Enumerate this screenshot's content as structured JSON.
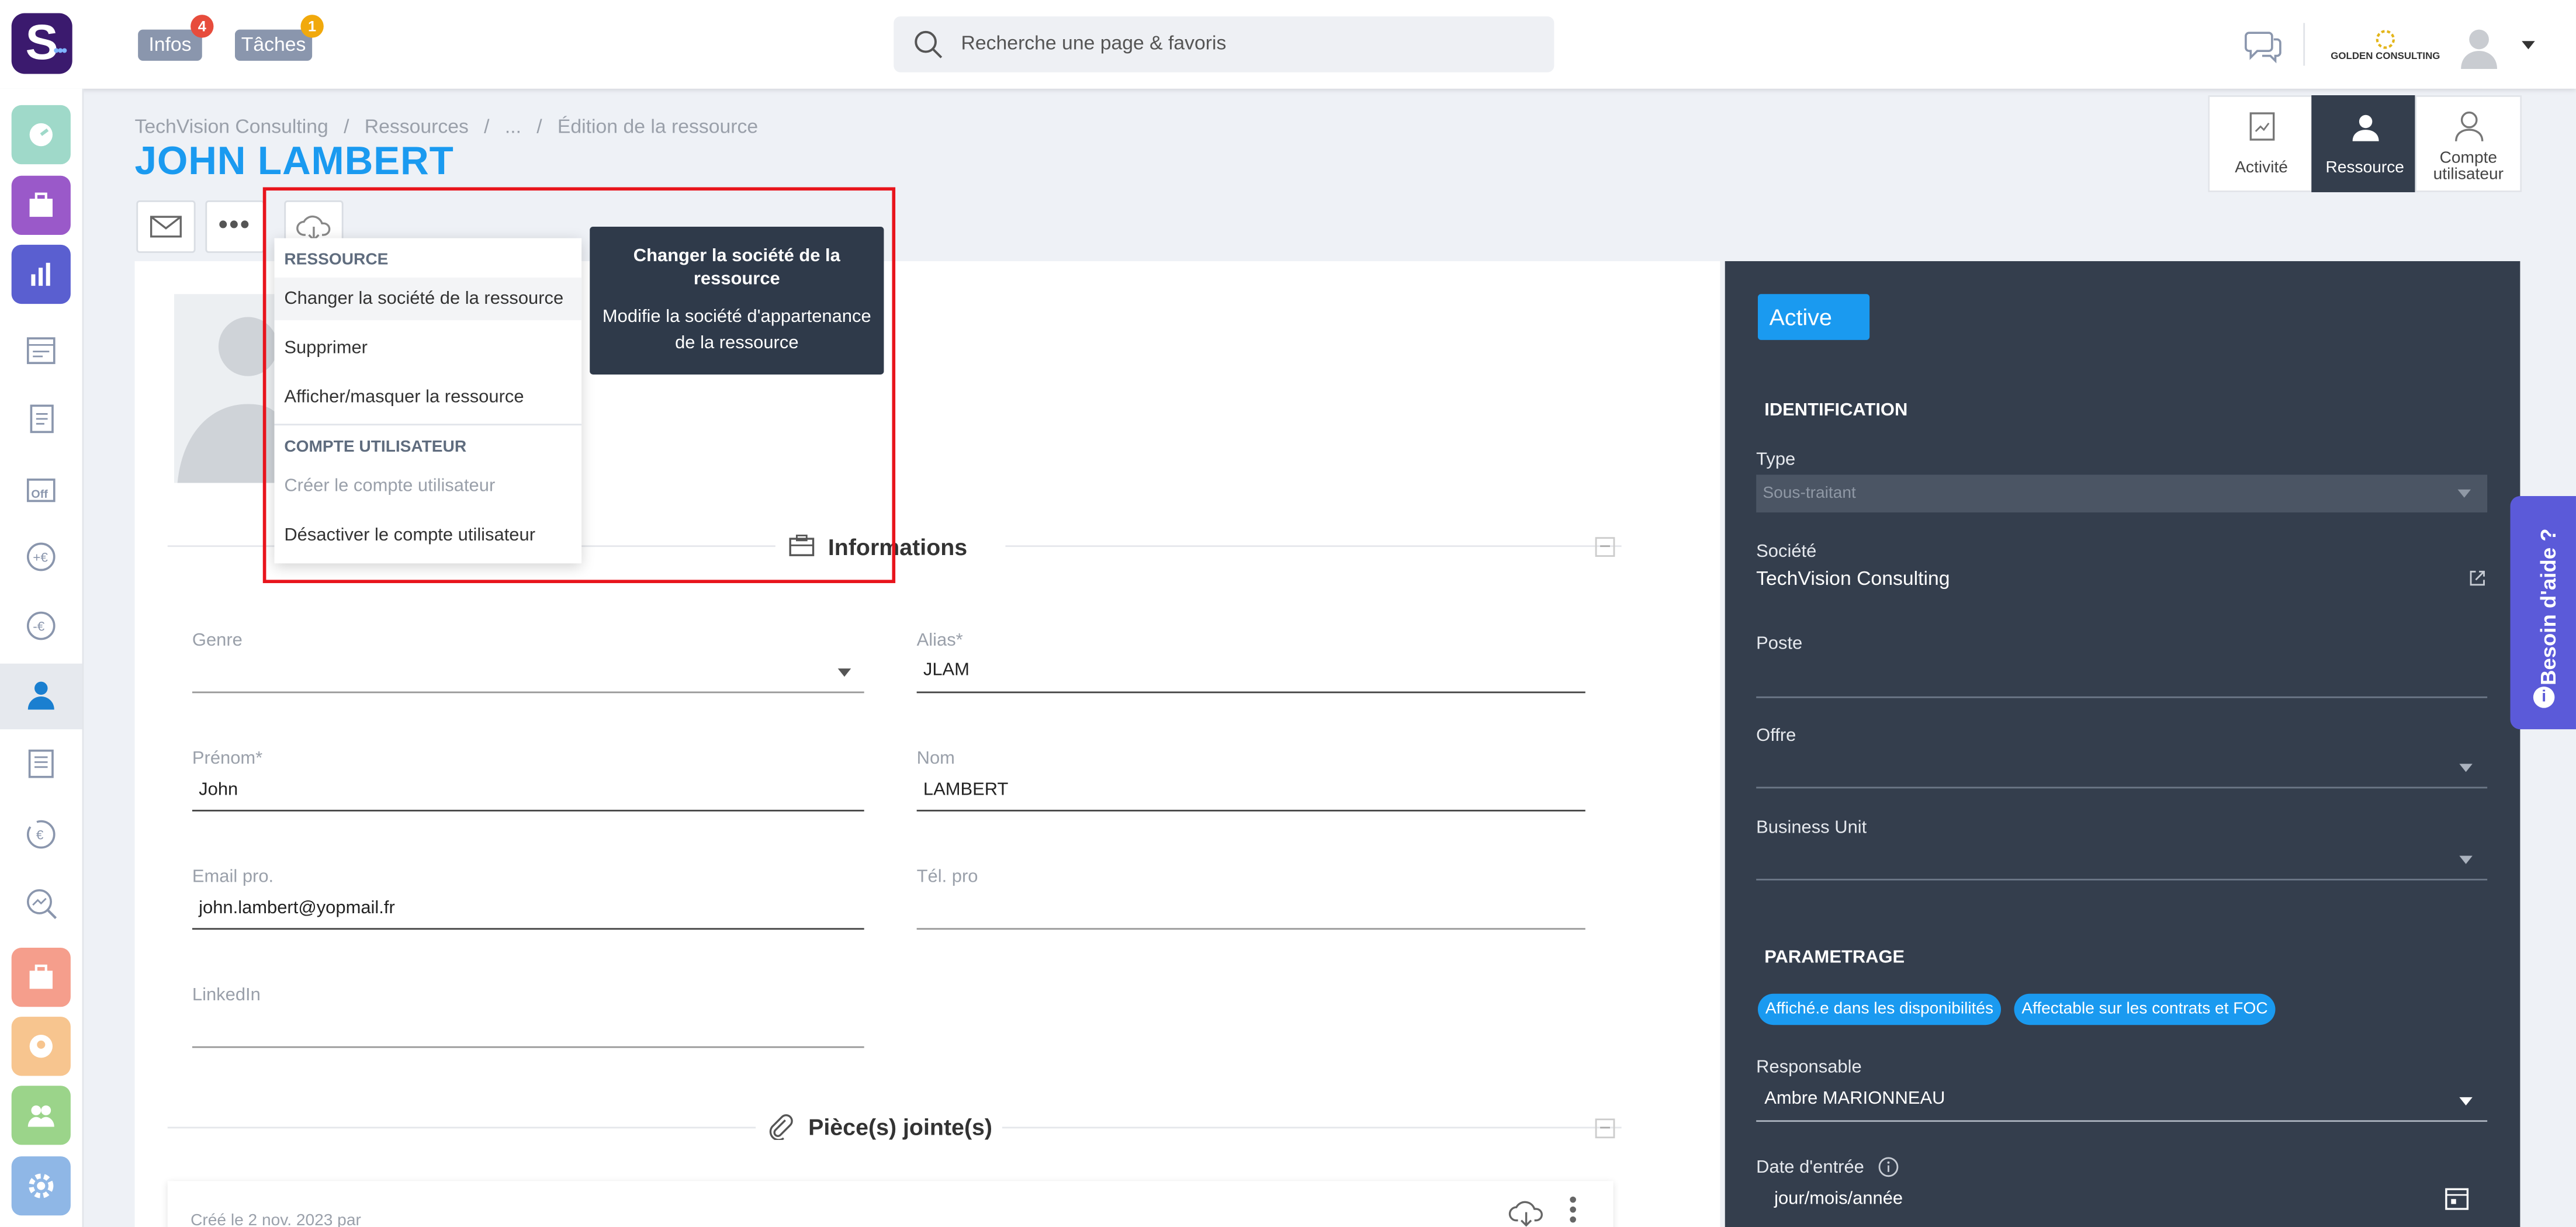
{
  "topbar": {
    "logo": "S",
    "infos": {
      "label": "Infos",
      "count": "4"
    },
    "taches": {
      "label": "Tâches",
      "count": "1"
    },
    "search_placeholder": "Recherche une page & favoris",
    "company_logo_text": "GOLDEN CONSULTING",
    "colors": {
      "infos_badge": "#e74c3c",
      "taches_badge": "#f1a90c",
      "tag": "#8a96ad"
    }
  },
  "sidebar": {
    "items": [
      "dashboard-icon",
      "briefcase-icon",
      "chart-icon",
      "calendar-icon",
      "document-icon",
      "off-icon",
      "money-in-icon",
      "money-out-icon",
      "user-icon",
      "list-icon",
      "refresh-money-icon",
      "analytics-icon",
      "briefcase-red-icon",
      "person-orange-icon",
      "group-green-icon",
      "gear-blue-icon"
    ]
  },
  "breadcrumb": {
    "items": [
      "TechVision Consulting",
      "Ressources",
      "...",
      "Édition de la ressource"
    ],
    "sep": "/"
  },
  "page_title": "JOHN LAMBERT",
  "view_switcher": [
    {
      "label": "Activité",
      "active": false
    },
    {
      "label": "Ressource",
      "active": true
    },
    {
      "label": "Compte utilisateur",
      "active": false
    }
  ],
  "menu": {
    "section1": "RESSOURCE",
    "items1": [
      "Changer la société de la ressource",
      "Supprimer",
      "Afficher/masquer la ressource"
    ],
    "section2": "COMPTE UTILISATEUR",
    "items2": [
      {
        "label": "Créer le compte utilisateur",
        "disabled": true
      },
      {
        "label": "Désactiver le compte utilisateur",
        "disabled": false
      }
    ]
  },
  "tooltip": {
    "title": "Changer la société de la ressource",
    "body": "Modifie la société d'appartenance de la ressource"
  },
  "informations": {
    "title": "Informations",
    "genre": {
      "label": "Genre",
      "value": ""
    },
    "alias": {
      "label": "Alias*",
      "value": "JLAM"
    },
    "prenom": {
      "label": "Prénom*",
      "value": "John"
    },
    "nom": {
      "label": "Nom",
      "value": "LAMBERT"
    },
    "email": {
      "label": "Email pro.",
      "value": "john.lambert@yopmail.fr"
    },
    "tel": {
      "label": "Tél. pro",
      "value": ""
    },
    "linkedin": {
      "label": "LinkedIn",
      "value": ""
    }
  },
  "pieces": {
    "title": "Pièce(s) jointe(s)",
    "created": "Créé le 2 nov. 2023 par"
  },
  "right": {
    "status": "Active",
    "identification": "IDENTIFICATION",
    "type": {
      "label": "Type",
      "value": "Sous-traitant"
    },
    "societe": {
      "label": "Société",
      "value": "TechVision Consulting"
    },
    "poste": {
      "label": "Poste",
      "value": ""
    },
    "offre": {
      "label": "Offre",
      "value": ""
    },
    "bu": {
      "label": "Business Unit",
      "value": ""
    },
    "parametrage": "PARAMETRAGE",
    "chips": [
      "Affiché.e dans les disponibilités",
      "Affectable sur les contrats et FOC"
    ],
    "responsable": {
      "label": "Responsable",
      "value": "Ambre MARIONNEAU"
    },
    "date_entree": {
      "label": "Date d'entrée",
      "value": "jour/mois/année"
    }
  },
  "help": "Besoin d'aide ?",
  "help_icon_glyph": "i"
}
